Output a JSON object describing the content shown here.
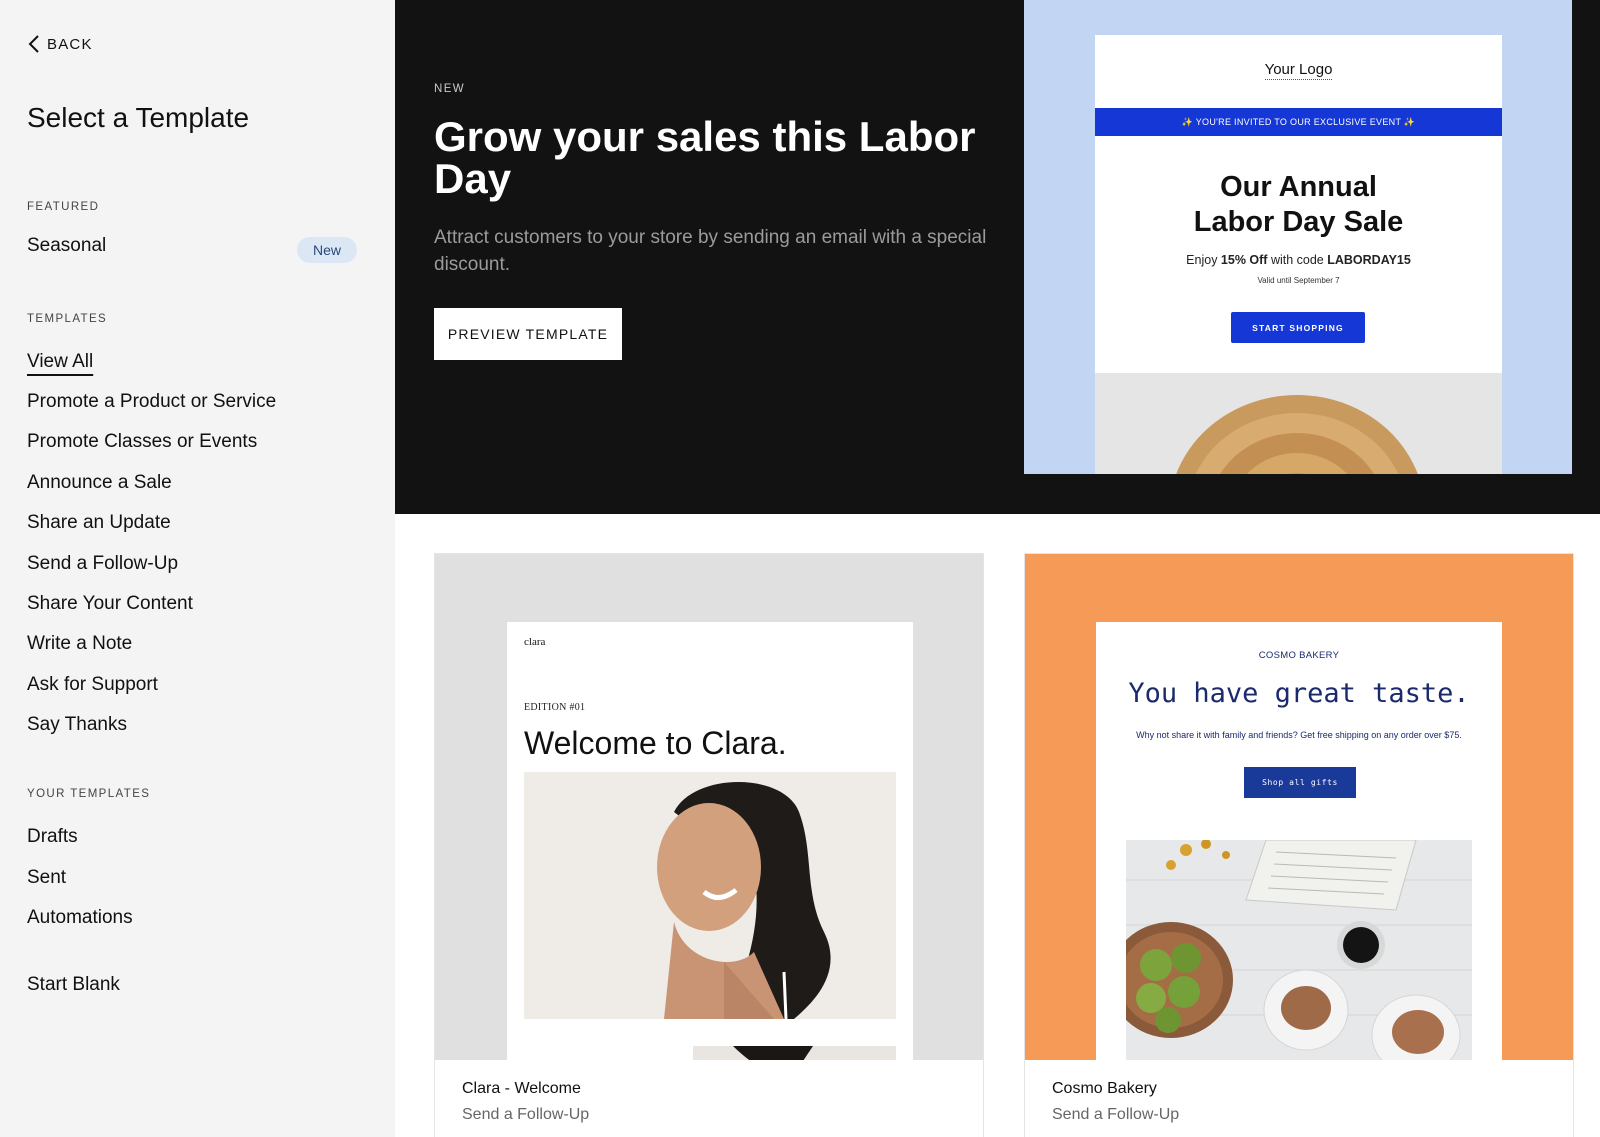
{
  "sidebar": {
    "back_label": "BACK",
    "title": "Select a Template",
    "featured_label": "FEATURED",
    "featured_item": "Seasonal",
    "featured_badge": "New",
    "templates_label": "TEMPLATES",
    "templates": [
      "View All",
      "Promote a Product or Service",
      "Promote Classes or Events",
      "Announce a Sale",
      "Share an Update",
      "Send a Follow-Up",
      "Share Your Content",
      "Write a Note",
      "Ask for Support",
      "Say Thanks"
    ],
    "active_template": "View All",
    "your_templates_label": "YOUR TEMPLATES",
    "your_templates": [
      "Drafts",
      "Sent",
      "Automations"
    ],
    "start_blank": "Start Blank"
  },
  "hero": {
    "kicker": "NEW",
    "title": "Grow your sales this Labor Day",
    "description": "Attract customers to your store by sending an email with a special discount.",
    "button_label": "PREVIEW TEMPLATE",
    "preview": {
      "logo_text": "Your Logo",
      "banner_text": "✨ YOU'RE INVITED TO OUR EXCLUSIVE EVENT ✨",
      "headline_line1": "Our Annual",
      "headline_line2": "Labor Day Sale",
      "offer_prefix": "Enjoy ",
      "offer_discount": "15% Off",
      "offer_middle": " with code ",
      "offer_code": "LABORDAY15",
      "valid_text": "Valid until September 7",
      "button_text": "START SHOPPING"
    }
  },
  "cards": [
    {
      "title": "Clara - Welcome",
      "subtitle": "Send a Follow-Up",
      "preview": {
        "brand": "clara",
        "edition": "EDITION #01",
        "headline": "Welcome to Clara."
      }
    },
    {
      "title": "Cosmo Bakery",
      "subtitle": "Send a Follow-Up",
      "preview": {
        "brand": "COSMO BAKERY",
        "headline": "You have great taste.",
        "subtext": "Why not share it with family and friends? Get free shipping on any order over $75.",
        "button_text": "Shop all gifts"
      }
    }
  ],
  "colors": {
    "hero_bg": "#121212",
    "hero_preview_bg": "#c2d6f4",
    "accent_blue": "#1437d6",
    "cosmo_bg": "#f59a57",
    "cosmo_navy": "#1a2a6c",
    "badge_bg": "#dbe7f5"
  }
}
